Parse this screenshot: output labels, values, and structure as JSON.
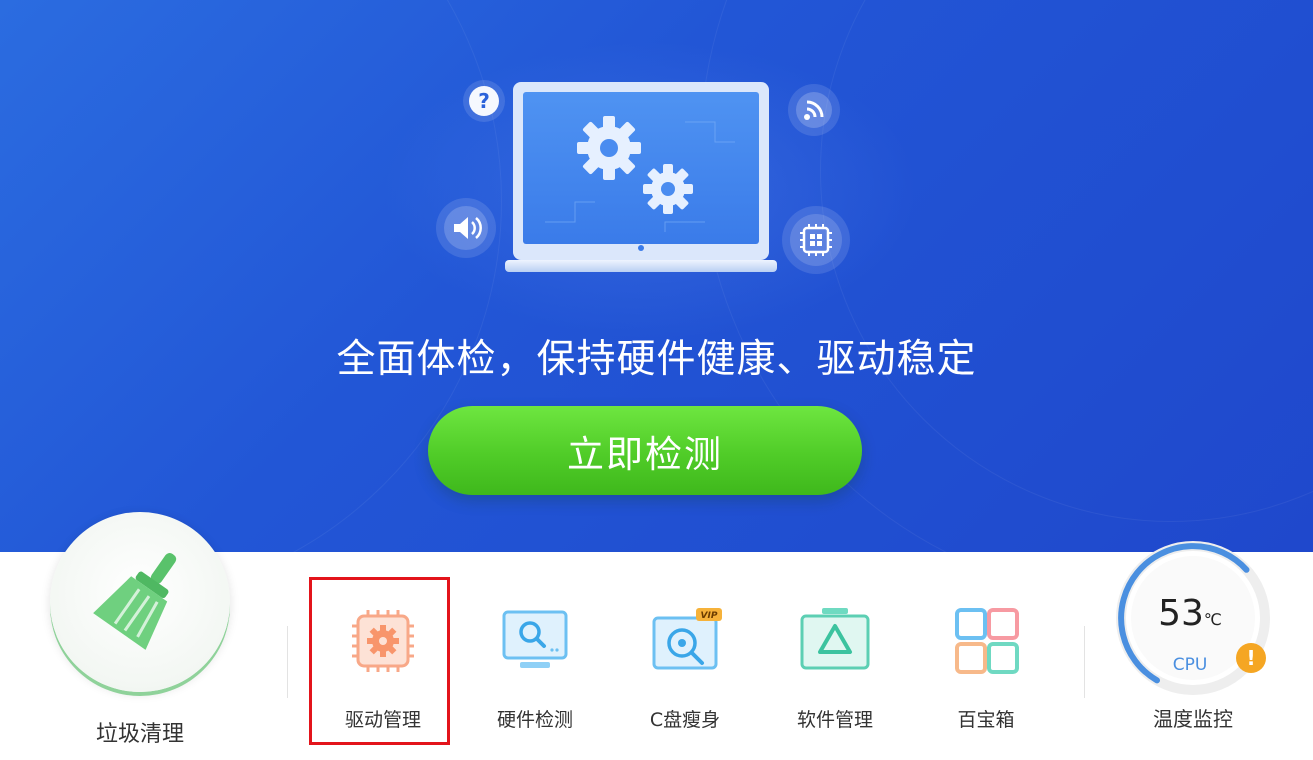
{
  "hero": {
    "headline": "全面体检，保持硬件健康、驱动稳定",
    "scan_button": "立即检测",
    "colors": {
      "background": "#2256d6",
      "button": "#50cc28"
    }
  },
  "clean": {
    "label": "垃圾清理",
    "icon": "broom-icon"
  },
  "tools": [
    {
      "label": "驱动管理",
      "icon": "chip-gear-icon",
      "highlighted": true
    },
    {
      "label": "硬件检测",
      "icon": "monitor-search-icon"
    },
    {
      "label": "C盘瘦身",
      "icon": "disk-vip-icon",
      "badge": "VIP"
    },
    {
      "label": "软件管理",
      "icon": "software-triangle-icon"
    },
    {
      "label": "百宝箱",
      "icon": "grid-apps-icon"
    }
  ],
  "temperature": {
    "value": "53",
    "unit": "℃",
    "sensor": "CPU",
    "warning": "!",
    "label": "温度监控",
    "gauge_fraction": 0.55
  },
  "colors": {
    "highlight_border": "#e3141b",
    "gauge": "#4a8fe0",
    "warning": "#f5a623"
  }
}
